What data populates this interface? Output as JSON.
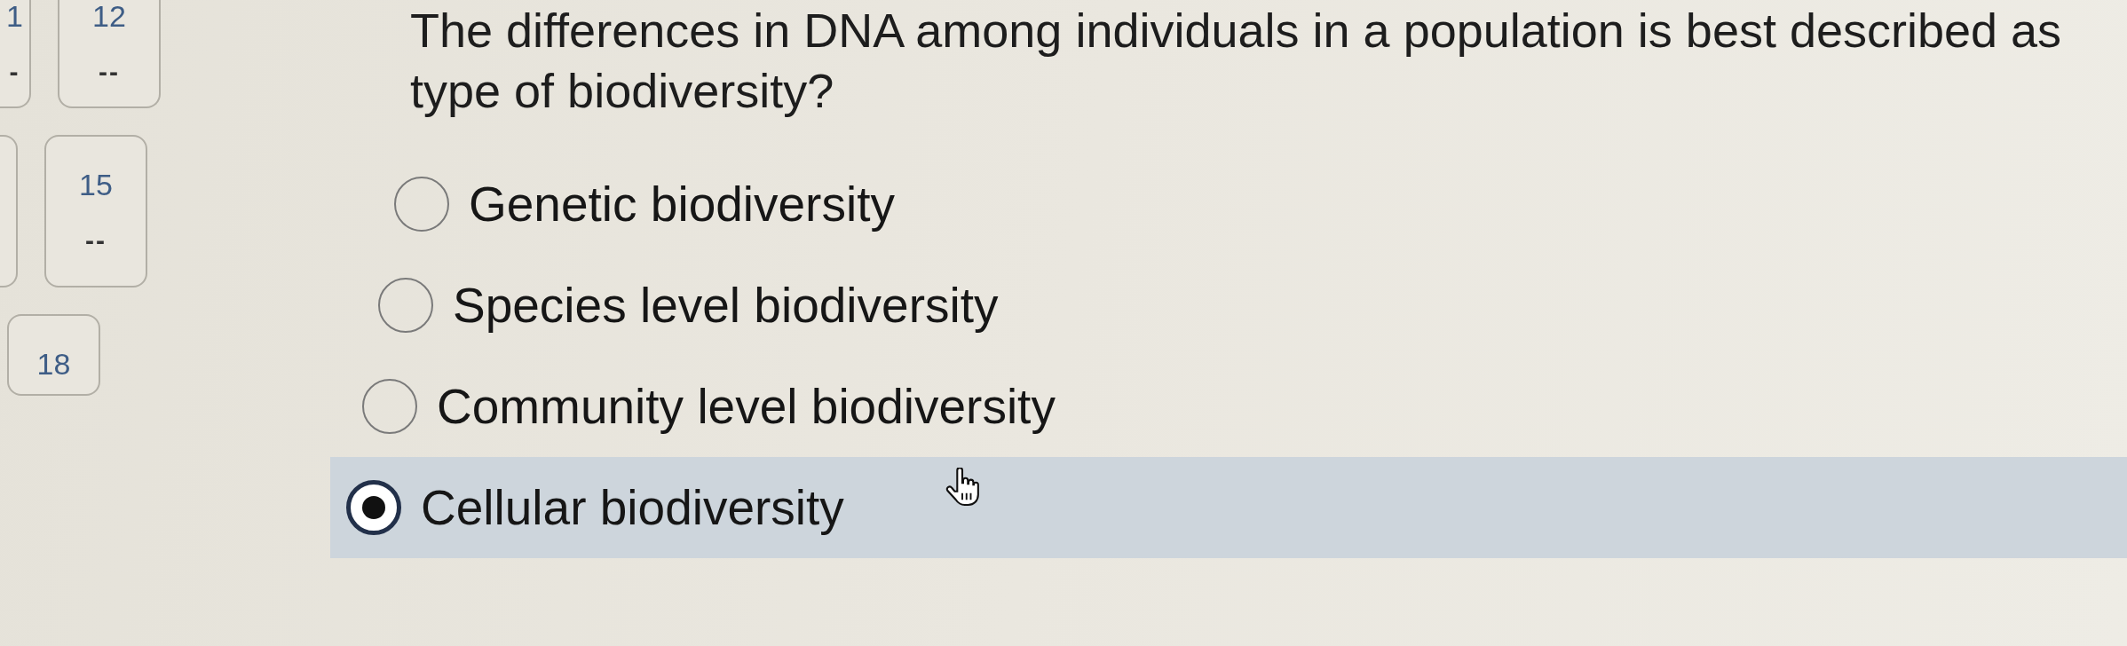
{
  "question_nav": {
    "rows": [
      {
        "tiles": [
          {
            "kind": "number",
            "number": "1",
            "answer": "-"
          },
          {
            "kind": "number",
            "number": "12",
            "answer": "--"
          }
        ]
      },
      {
        "tiles": [
          {
            "kind": "blank"
          },
          {
            "kind": "number",
            "number": "15",
            "answer": "--"
          }
        ]
      },
      {
        "tiles": [
          {
            "kind": "number",
            "number": "18"
          }
        ]
      }
    ]
  },
  "question": {
    "text": "The differences in DNA among individuals in a population is best described as type of biodiversity?",
    "options": [
      {
        "label": "Genetic biodiversity",
        "selected": false
      },
      {
        "label": "Species level biodiversity",
        "selected": false
      },
      {
        "label": "Community level biodiversity",
        "selected": false
      },
      {
        "label": "Cellular biodiversity",
        "selected": true
      }
    ]
  }
}
